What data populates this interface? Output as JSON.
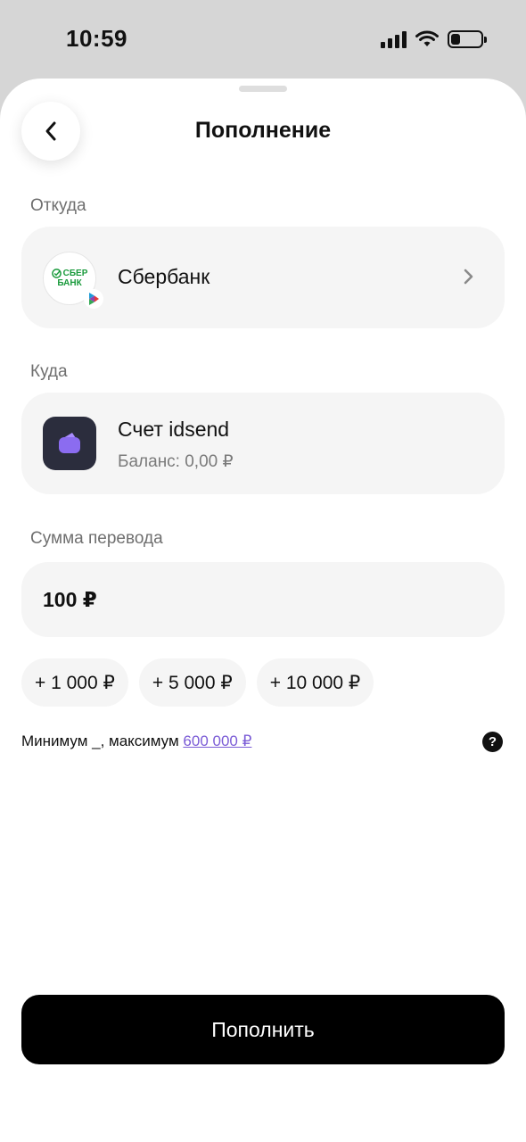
{
  "status_bar": {
    "time": "10:59",
    "icons": [
      "cellular-signal-icon",
      "wifi-icon",
      "battery-icon"
    ]
  },
  "header": {
    "title": "Пополнение",
    "back_icon": "chevron-left-icon"
  },
  "from_section": {
    "label": "Откуда",
    "bank_name": "Сбербанк",
    "logo_line1": "СБЕР",
    "logo_line2": "БАНК",
    "logo_icon": "sberbank-logo-icon",
    "badge_icon": "sbp-icon",
    "chevron_icon": "chevron-right-icon"
  },
  "to_section": {
    "label": "Куда",
    "account_name": "Счет idsend",
    "balance": "Баланс: 0,00 ₽",
    "icon": "wallet-icon"
  },
  "amount_section": {
    "label": "Сумма перевода",
    "value": "100 ₽",
    "quick_add": [
      "+ 1 000 ₽",
      "+ 5 000 ₽",
      "+ 10 000 ₽"
    ],
    "limits_prefix": "Минимум _, максимум ",
    "limits_max": "600 000 ₽",
    "help_icon": "question-icon",
    "help_glyph": "?"
  },
  "submit_label": "Пополнить",
  "colors": {
    "accent_link": "#7b5cd6",
    "sber_green": "#1a9a3c",
    "wallet_purple": "#8b6cf0",
    "card_bg": "#f5f5f5",
    "button_bg": "#000000"
  }
}
